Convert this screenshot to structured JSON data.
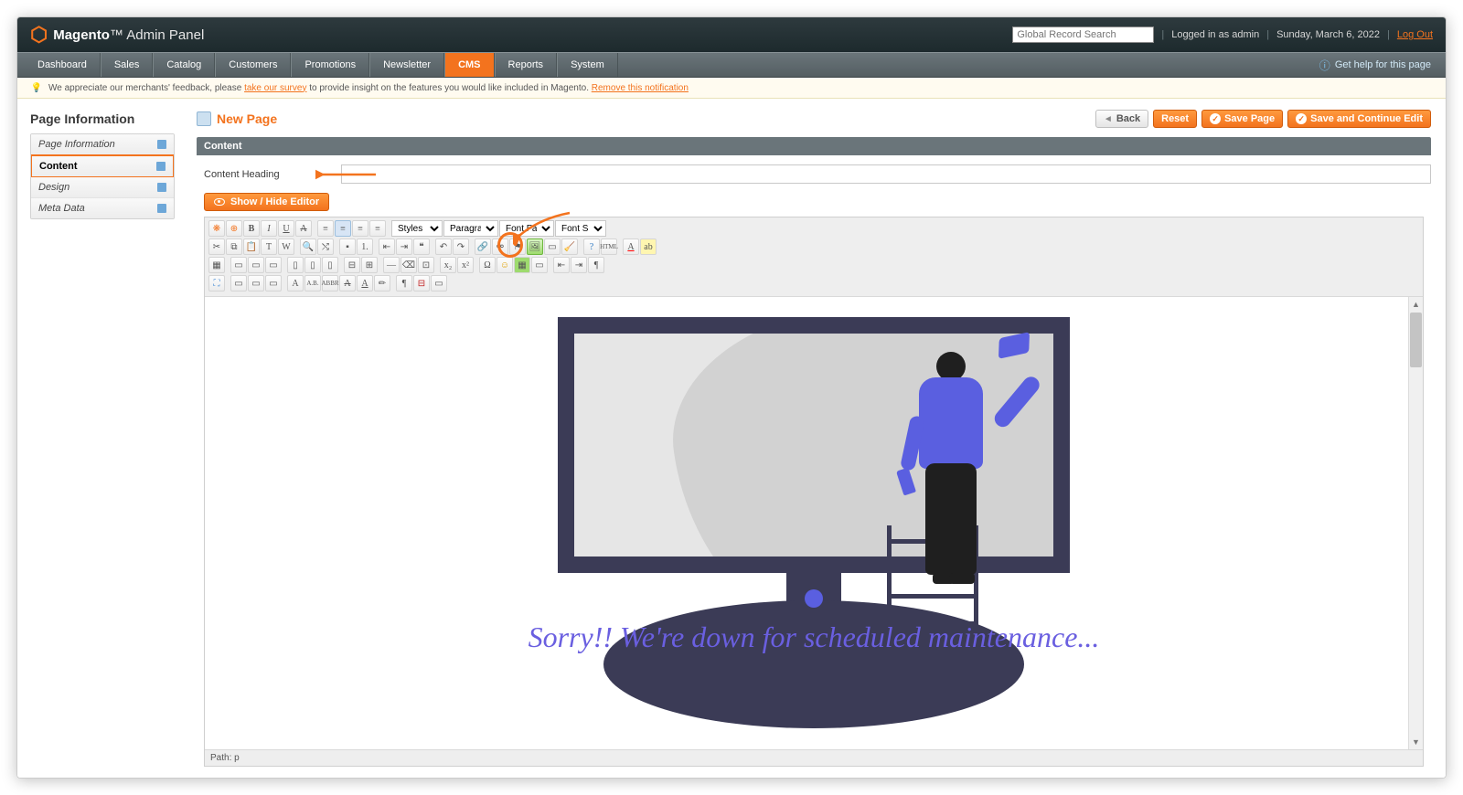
{
  "header": {
    "brand": "Magento",
    "panel": "Admin Panel",
    "search_placeholder": "Global Record Search",
    "logged_in": "Logged in as admin",
    "date": "Sunday, March 6, 2022",
    "logout": "Log Out"
  },
  "nav": {
    "items": [
      "Dashboard",
      "Sales",
      "Catalog",
      "Customers",
      "Promotions",
      "Newsletter",
      "CMS",
      "Reports",
      "System"
    ],
    "active": "CMS",
    "help": "Get help for this page"
  },
  "notice": {
    "prefix": "We appreciate our merchants' feedback, please ",
    "survey_link": "take our survey",
    "middle": " to provide insight on the features you would like included in Magento. ",
    "remove_link": "Remove this notification"
  },
  "sidebar": {
    "title": "Page Information",
    "tabs": [
      {
        "label": "Page Information",
        "active": false
      },
      {
        "label": "Content",
        "active": true
      },
      {
        "label": "Design",
        "active": false
      },
      {
        "label": "Meta Data",
        "active": false
      }
    ]
  },
  "page": {
    "title": "New Page",
    "buttons": {
      "back": "Back",
      "reset": "Reset",
      "save": "Save Page",
      "save_continue": "Save and Continue Edit"
    }
  },
  "content": {
    "section_header": "Content",
    "heading_label": "Content Heading",
    "heading_value": "",
    "toggle_editor": "Show / Hide Editor",
    "toolbar": {
      "styles": "Styles",
      "format": "Paragraph",
      "font_family": "Font Family",
      "font_size": "Font Size"
    },
    "canvas_text": "Sorry!! We're down for scheduled maintenance...",
    "footer_path": "Path: p"
  }
}
